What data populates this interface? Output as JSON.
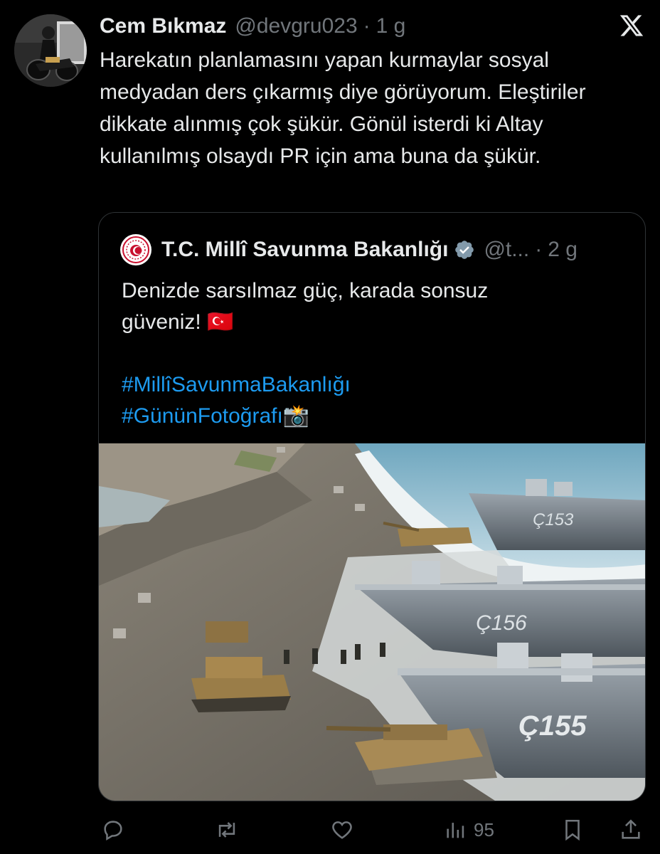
{
  "tweet": {
    "author_name": "Cem Bıkmaz",
    "handle": "@devgru023",
    "separator": "·",
    "time": "1 g",
    "text": "Harekatın planlamasını yapan kurmaylar sosyal medyadan ders çıkarmış diye görüyorum. Eleştiriler dikkate alınmış çok şükür. Gönül isterdi ki Altay kullanılmış olsaydı PR için ama buna da şükür."
  },
  "quote": {
    "author_name": "T.C. Millî Savunma Bakanlığı",
    "handle": "@t...",
    "separator": "·",
    "time": "2 g",
    "text_line": "Denizde sarsılmaz güç, karada sonsuz güveniz! 🇹🇷",
    "hashtag_1": "#MillîSavunmaBakanlığı",
    "hashtag_2": "#GününFotoğrafı📸",
    "photo": {
      "ship_labels": [
        "Ç153",
        "Ç156",
        "Ç155"
      ]
    }
  },
  "actions": {
    "views_count": "95"
  },
  "colors": {
    "background": "#000000",
    "text": "#e7e9ea",
    "muted": "#71767b",
    "link": "#1d9bf0",
    "border": "#2f3336"
  }
}
